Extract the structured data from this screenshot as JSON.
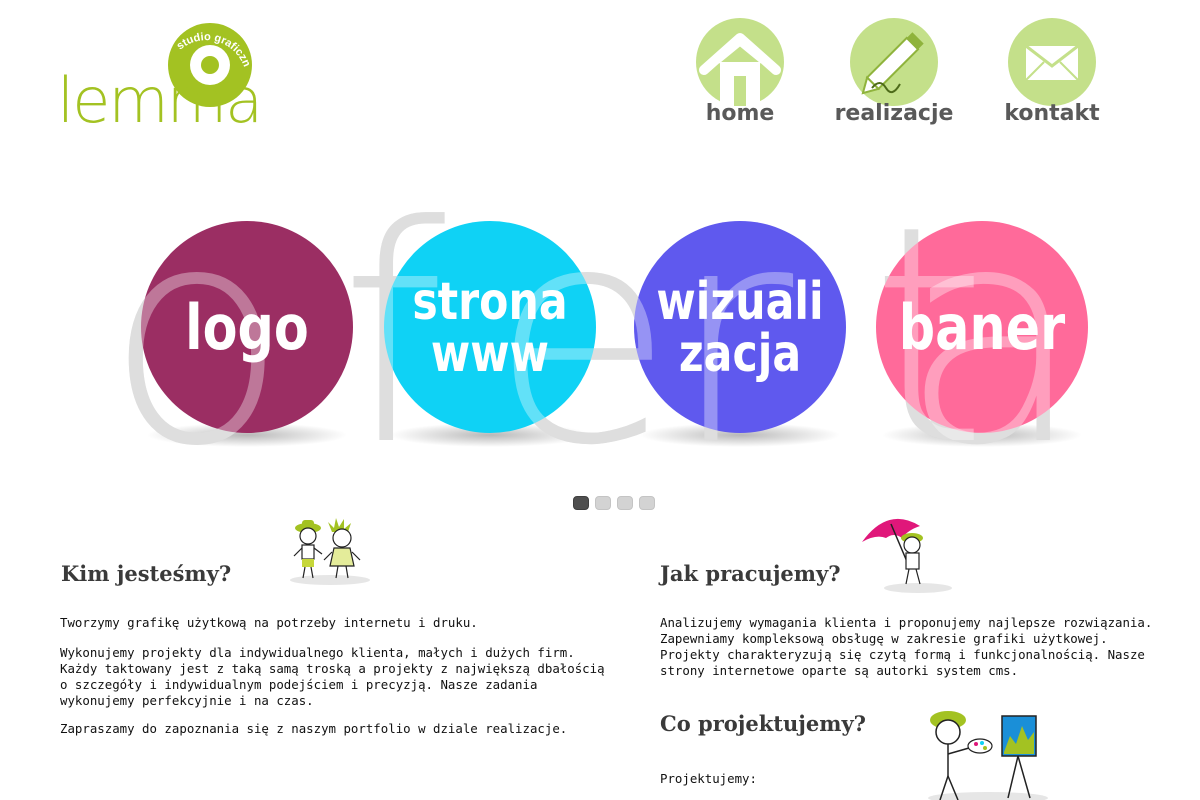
{
  "header": {
    "logo_word": "lemma",
    "logo_tagline": "studio graficzne"
  },
  "nav": [
    {
      "label": "home",
      "icon": "house-icon"
    },
    {
      "label": "realizacje",
      "icon": "pencil-icon"
    },
    {
      "label": "kontakt",
      "icon": "envelope-icon"
    }
  ],
  "slider": {
    "backdrop_text": "oferta",
    "circles": [
      {
        "line1": "logo",
        "line2": "",
        "color": "#9b2e63"
      },
      {
        "line1": "strona",
        "line2": "www",
        "color": "#0fd2f5"
      },
      {
        "line1": "wizuali",
        "line2": "zacja",
        "color": "#5f59ee"
      },
      {
        "line1": "baner",
        "line2": "",
        "color": "#ff6a9a"
      }
    ],
    "dots_total": 4,
    "active_dot": 1
  },
  "left": {
    "title": "Kim jesteśmy?",
    "p1": "Tworzymy grafikę użytkową na potrzeby internetu i druku.",
    "p2": "Wykonujemy projekty dla indywidualnego klienta, małych i dużych firm. Każdy taktowany jest z taką samą troską a projekty z największą dbałością o szczegóły i indywidualnym podejściem i precyzją. Nasze zadania wykonujemy perfekcyjnie i na czas.",
    "p3": "Zapraszamy do zapoznania się z naszym portfolio w dziale realizacje."
  },
  "right": {
    "title1": "Jak pracujemy?",
    "p1": "Analizujemy wymagania klienta i proponujemy najlepsze rozwiązania. Zapewniamy kompleksową obsługę w zakresie grafiki użytkowej. Projekty charakteryzują się czytą formą i funkcjonalnością. Nasze strony internetowe oparte są autorki system cms.",
    "title2": "Co projektujemy?",
    "p2": "Projektujemy:"
  },
  "colors": {
    "brand_green": "#a3c222",
    "icon_green": "#c4e08a",
    "nav_text": "#595959",
    "backdrop_gray": "#cccccc"
  }
}
